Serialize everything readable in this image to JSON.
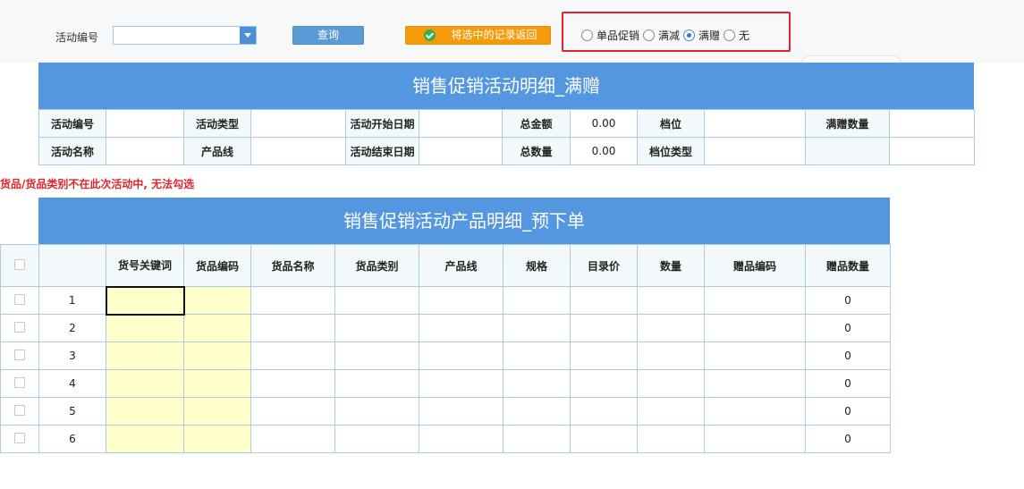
{
  "toolbar": {
    "activity_no_label": "活动编号",
    "activity_no_value": "",
    "query_label": "查询",
    "return_label": "将选中的记录返回",
    "promo_types": [
      {
        "label": "单品促销",
        "checked": false
      },
      {
        "label": "满减",
        "checked": false
      },
      {
        "label": "满赠",
        "checked": true
      },
      {
        "label": "无",
        "checked": false
      }
    ]
  },
  "detail": {
    "title": "销售促销活动明细_满赠",
    "labels": {
      "activity_no": "活动编号",
      "activity_type": "活动类型",
      "start_date": "活动开始日期",
      "total_amount": "总金额",
      "tier": "档位",
      "gift_qty": "满赠数量",
      "activity_name": "活动名称",
      "product_line": "产品线",
      "end_date": "活动结束日期",
      "total_qty": "总数量",
      "tier_type": "档位类型"
    },
    "values": {
      "total_amount": "0.00",
      "total_qty": "0.00"
    }
  },
  "warning": "货品/货品类别不在此次活动中, 无法勾选",
  "products": {
    "title": "销售促销活动产品明细_预下单",
    "columns": [
      "货号关键词",
      "货品编码",
      "货品名称",
      "货品类别",
      "产品线",
      "规格",
      "目录价",
      "数量",
      "赠品编码",
      "赠品数量"
    ],
    "rows": [
      {
        "no": "1",
        "gift_qty": "0"
      },
      {
        "no": "2",
        "gift_qty": "0"
      },
      {
        "no": "3",
        "gift_qty": "0"
      },
      {
        "no": "4",
        "gift_qty": "0"
      },
      {
        "no": "5",
        "gift_qty": "0"
      },
      {
        "no": "6",
        "gift_qty": "0"
      }
    ]
  }
}
